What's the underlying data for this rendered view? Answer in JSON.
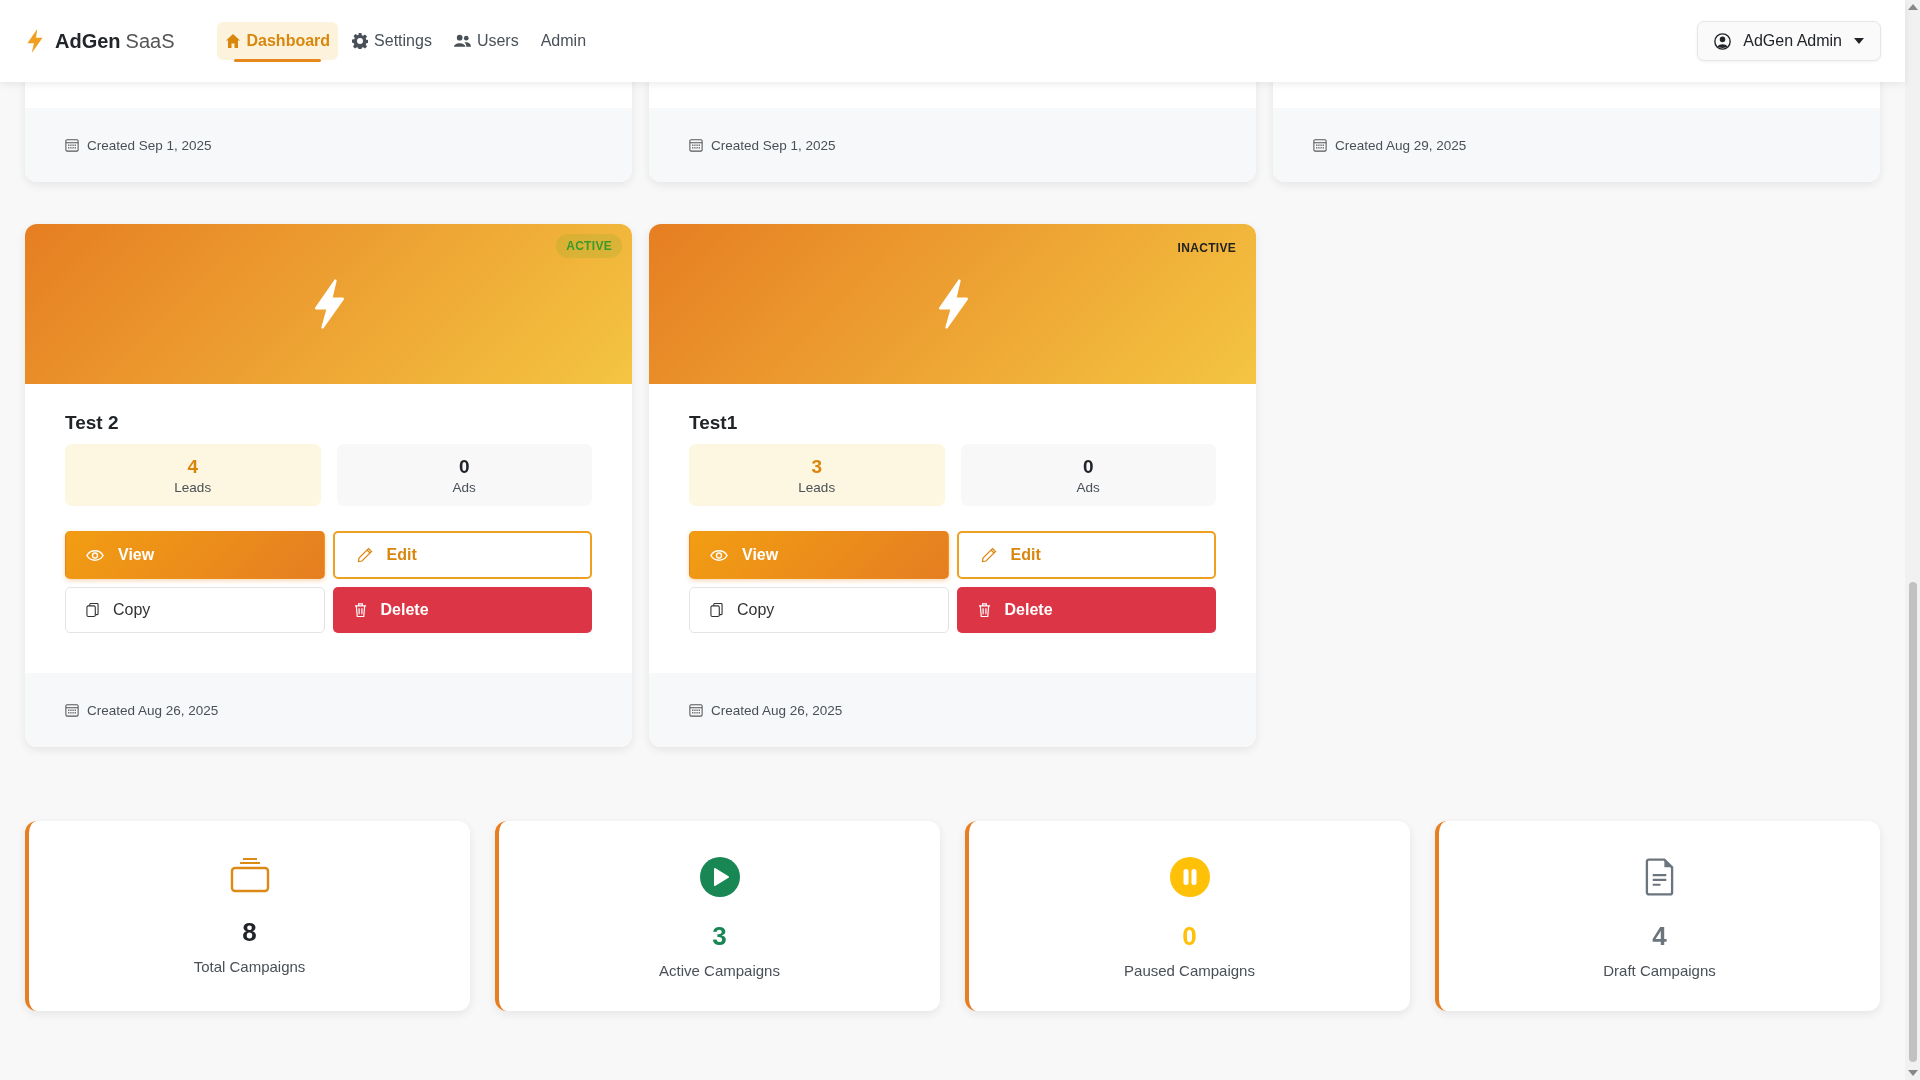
{
  "navbar": {
    "brand_bold": "AdGen",
    "brand_light": "SaaS",
    "nav_items": [
      {
        "label": "Dashboard",
        "kind": "home",
        "selected": true
      },
      {
        "label": "Settings",
        "kind": "gear",
        "selected": false
      },
      {
        "label": "Users",
        "kind": "users",
        "selected": false
      },
      {
        "label": "Admin",
        "kind": "plain",
        "selected": false
      }
    ],
    "user_menu": {
      "label": "AdGen Admin"
    }
  },
  "top_cards": [
    {
      "created": "Created Sep 1, 2025"
    },
    {
      "created": "Created Sep 1, 2025"
    },
    {
      "created": "Created Aug 29, 2025"
    }
  ],
  "campaign_cards": [
    {
      "title": "Test 2",
      "active": true,
      "badge": "ACTIVE",
      "leads": "4",
      "leads_label": "Leads",
      "ads": "0",
      "ads_label": "Ads",
      "buttons": [
        {
          "kind": "view",
          "label": "View"
        },
        {
          "kind": "edit",
          "label": "Edit"
        },
        {
          "kind": "copy",
          "label": "Copy"
        },
        {
          "kind": "delete",
          "label": "Delete"
        }
      ],
      "created": "Created Aug 26, 2025"
    },
    {
      "title": "Test1",
      "active": false,
      "badge": "INACTIVE",
      "leads": "3",
      "leads_label": "Leads",
      "ads": "0",
      "ads_label": "Ads",
      "buttons": [
        {
          "kind": "view",
          "label": "View"
        },
        {
          "kind": "edit",
          "label": "Edit"
        },
        {
          "kind": "copy",
          "label": "Copy"
        },
        {
          "kind": "delete",
          "label": "Delete"
        }
      ],
      "created": "Created Aug 26, 2025"
    }
  ],
  "stats": [
    {
      "kind": "total",
      "value": "8",
      "label": "Total Campaigns"
    },
    {
      "kind": "active",
      "value": "3",
      "label": "Active Campaigns"
    },
    {
      "kind": "paused",
      "value": "0",
      "label": "Paused Campaigns"
    },
    {
      "kind": "draft",
      "value": "4",
      "label": "Draft Campaigns"
    }
  ]
}
